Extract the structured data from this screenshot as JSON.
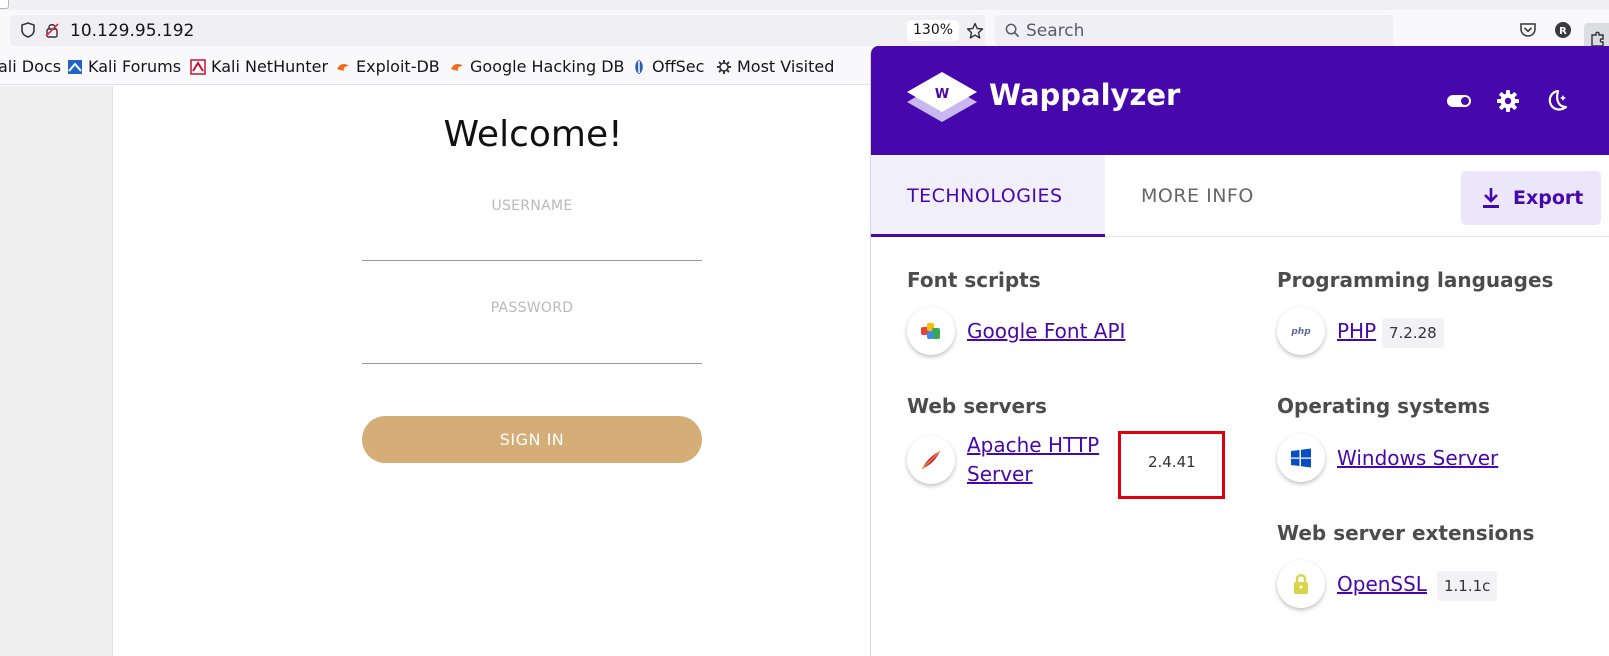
{
  "browser": {
    "url": "10.129.95.192",
    "zoom": "130%",
    "search_placeholder": "Search"
  },
  "bookmarks": [
    {
      "label": "ali Docs"
    },
    {
      "label": "Kali Forums"
    },
    {
      "label": "Kali NetHunter"
    },
    {
      "label": "Exploit-DB"
    },
    {
      "label": "Google Hacking DB"
    },
    {
      "label": "OffSec"
    },
    {
      "label": "Most Visited"
    }
  ],
  "login": {
    "title": "Welcome!",
    "username_label": "USERNAME",
    "password_label": "PASSWORD",
    "signin_label": "SIGN IN"
  },
  "wappalyzer": {
    "title": "Wappalyzer",
    "tabs": [
      {
        "label": "TECHNOLOGIES",
        "active": true
      },
      {
        "label": "MORE INFO",
        "active": false
      }
    ],
    "export_label": "Export",
    "categories": [
      {
        "name": "Font scripts",
        "techs": [
          {
            "name": "Google Font API",
            "icon": "google-font-api-icon"
          }
        ]
      },
      {
        "name": "Web servers",
        "techs": [
          {
            "name": "Apache HTTP Server",
            "line1": "Apache HTTP",
            "line2": "Server",
            "version": "2.4.41",
            "icon": "apache-feather-icon",
            "highlighted": true
          }
        ]
      },
      {
        "name": "Programming languages",
        "techs": [
          {
            "name": "PHP",
            "version": "7.2.28",
            "icon": "php-icon"
          }
        ]
      },
      {
        "name": "Operating systems",
        "techs": [
          {
            "name": "Windows Server",
            "icon": "windows-icon"
          }
        ]
      },
      {
        "name": "Web server extensions",
        "techs": [
          {
            "name": "OpenSSL",
            "version": "1.1.1c",
            "icon": "lock-icon"
          }
        ]
      }
    ],
    "colors": {
      "brand": "#4608ad",
      "highlight": "#e0000b",
      "signin": "#d4ad77"
    }
  }
}
